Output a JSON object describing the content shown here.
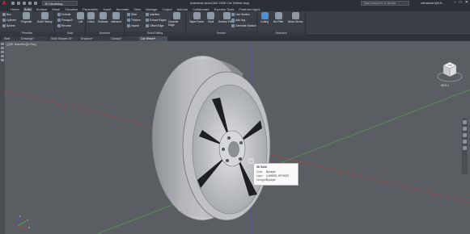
{
  "titlebar": {
    "app_letter": "A",
    "workspace": "3D Modeling",
    "title": "Autodesk AutoCAD 2020  Car Wheel.dwg",
    "search_placeholder": "Type a keyword or phrase",
    "user": "cdhaehan@15...",
    "controls": [
      "–",
      "□",
      "✕"
    ]
  },
  "menu": {
    "tabs": [
      "Home",
      "Solid",
      "Surface",
      "Mesh",
      "Visualize",
      "Parametric",
      "Insert",
      "Annotate",
      "View",
      "Manage",
      "Output",
      "Add-ins",
      "Collaborate",
      "Express Tools",
      "Featured Apps"
    ],
    "active": "Solid"
  },
  "ribbon": {
    "primitive": {
      "title": "Primitive",
      "box": "Box",
      "cylinder": "Cylinder",
      "sphere": "Sphere",
      "polysolid": "Polysolid",
      "solid_history": "Solid History"
    },
    "solid": {
      "title": "Solid",
      "extrude": "Extrude",
      "presspull": "Presspull",
      "revolve": "Revolve",
      "loft": "Loft"
    },
    "boolean": {
      "title": "Boolean",
      "union": "Union",
      "subtract": "Subtract",
      "intersect": "Intersect"
    },
    "solid_editing": {
      "title": "Solid Editing",
      "slice": "Slice",
      "thicken": "Thicken",
      "imprint": "Imprint",
      "interfere": "Interfere",
      "extract_edges": "Extract Edges",
      "offset_edge": "Offset Edge",
      "chamfer_edge": "Chamfer Edge"
    },
    "section": {
      "title": "Section",
      "taper_faces": "Taper Faces",
      "shell": "Shell",
      "section_plane": "Section Plane",
      "live_section": "Live Section",
      "add_jog": "Add Jog",
      "generate_section": "Generate Section"
    },
    "selection": {
      "title": "Selection",
      "culling": "Culling",
      "no_filter": "No Filter",
      "move_gizmo": "Move Gizmo"
    }
  },
  "doc_tabs": [
    "Start",
    "Drawing1*",
    "Solid Shapes 01*",
    "Dropbox*",
    "Canopy*",
    "Car Wheel*"
  ],
  "active_doc": "Car Wheel*",
  "viewport": {
    "label": "[-][SE Isometric][X-Ray]",
    "viewcube_label": "TOP",
    "wcs_label": "WCS ▾"
  },
  "tooltip": {
    "title": "3D Solid",
    "rows": [
      {
        "key": "Color",
        "value": "ByLayer"
      },
      {
        "key": "Layer",
        "value": "0-WHEEL SPOKES"
      },
      {
        "key": "Linetype",
        "value": "ByLayer"
      }
    ]
  },
  "ucs": {
    "x": "X",
    "y": "Y",
    "z": "Z"
  },
  "colors": {
    "titlebar": "#2b2f36",
    "ribbon": "#3a3f47",
    "viewport": "#5a5d61",
    "accent": "#4f8fd0"
  }
}
